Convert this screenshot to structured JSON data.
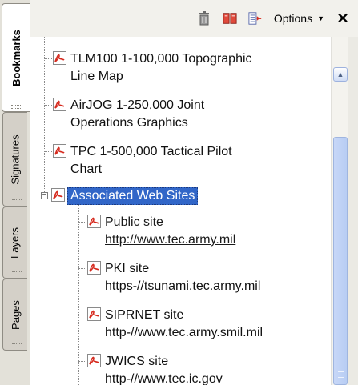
{
  "tabs": [
    {
      "label": "Bookmarks",
      "active": true
    },
    {
      "label": "Signatures",
      "active": false
    },
    {
      "label": "Layers",
      "active": false
    },
    {
      "label": "Pages",
      "active": false
    }
  ],
  "toolbar": {
    "icons": [
      "trash-icon",
      "book-icon",
      "bookmark-arrow-icon"
    ],
    "options_label": "Options",
    "close_label": "✕"
  },
  "bookmarks": {
    "items": [
      {
        "line1": "TLM100 1-100,000 Topographic",
        "line2": "Line Map"
      },
      {
        "line1": "AirJOG 1-250,000 Joint",
        "line2": "Operations Graphics"
      },
      {
        "line1": "TPC 1-500,000 Tactical Pilot",
        "line2": "Chart"
      }
    ],
    "group": {
      "label": "Associated Web Sites",
      "expanded": true,
      "selected": true
    },
    "sites": [
      {
        "line1": "Public site ",
        "line2": "http://www.tec.army.mil",
        "underlined": true
      },
      {
        "line1": "PKI site",
        "line2": "https-//tsunami.tec.army.mil",
        "underlined": false
      },
      {
        "line1": "SIPRNET site",
        "line2": "http-//www.tec.army.smil.mil",
        "underlined": false
      },
      {
        "line1": "JWICS site",
        "line2": "http-//www.tec.ic.gov",
        "underlined": false
      }
    ]
  },
  "colors": {
    "selection": "#3166c8",
    "pdf_red": "#d62a1e",
    "scrollbar": "#b8cdf3"
  }
}
